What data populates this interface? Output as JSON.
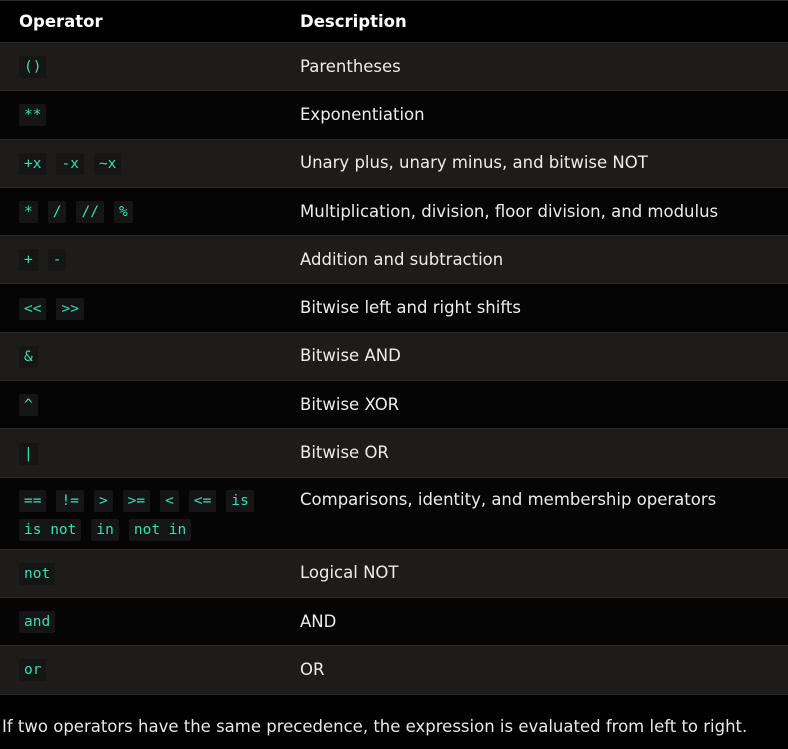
{
  "table": {
    "headers": {
      "operator": "Operator",
      "description": "Description"
    },
    "rows": [
      {
        "ops": [
          "()"
        ],
        "description": "Parentheses"
      },
      {
        "ops": [
          "**"
        ],
        "description": "Exponentiation"
      },
      {
        "ops": [
          "+x",
          "-x",
          "~x"
        ],
        "description": "Unary plus, unary minus, and bitwise NOT"
      },
      {
        "ops": [
          "*",
          "/",
          "//",
          "%"
        ],
        "description": "Multiplication, division, floor division, and modulus"
      },
      {
        "ops": [
          "+",
          "-"
        ],
        "description": "Addition and subtraction"
      },
      {
        "ops": [
          "<<",
          ">>"
        ],
        "description": "Bitwise left and right shifts"
      },
      {
        "ops": [
          "&"
        ],
        "description": "Bitwise AND"
      },
      {
        "ops": [
          "^"
        ],
        "description": "Bitwise XOR"
      },
      {
        "ops": [
          "|"
        ],
        "description": "Bitwise OR"
      },
      {
        "ops": [
          "==",
          "!=",
          ">",
          ">=",
          "<",
          "<=",
          "is",
          "is not",
          "in",
          "not in"
        ],
        "description": "Comparisons, identity, and membership operators"
      },
      {
        "ops": [
          "not"
        ],
        "description": "Logical NOT"
      },
      {
        "ops": [
          "and"
        ],
        "description": "AND"
      },
      {
        "ops": [
          "or"
        ],
        "description": "OR"
      }
    ]
  },
  "footer_text": "If two operators have the same precedence, the expression is evaluated from left to right.",
  "colors": {
    "operator_code": "#35e0b3",
    "row_odd": "#1d1c1b",
    "row_even": "#050505"
  }
}
